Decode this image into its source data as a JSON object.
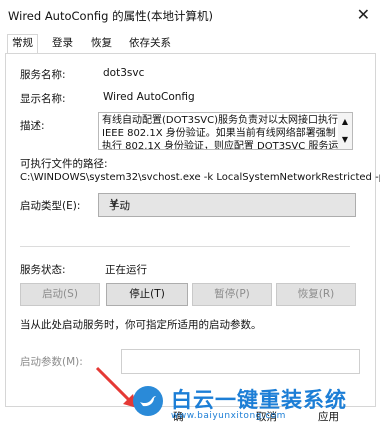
{
  "window": {
    "title": "Wired AutoConfig 的属性(本地计算机)"
  },
  "tabs": [
    {
      "label": "常规"
    },
    {
      "label": "登录"
    },
    {
      "label": "恢复"
    },
    {
      "label": "依存关系"
    }
  ],
  "general": {
    "service_name_label": "服务名称:",
    "service_name": "dot3svc",
    "display_name_label": "显示名称:",
    "display_name": "Wired AutoConfig",
    "description_label": "描述:",
    "description": "有线自动配置(DOT3SVC)服务负责对以太网接口执行 IEEE 802.1X 身份验证。如果当前有线网络部署强制执行 802.1X 身份验证，则应配置 DOT3SVC 服务运行以",
    "exec_path_label": "可执行文件的路径:",
    "exec_path": "C:\\WINDOWS\\system32\\svchost.exe -k LocalSystemNetworkRestricted -p",
    "startup_type_label": "启动类型(E):",
    "startup_type": "手动",
    "status_label": "服务状态:",
    "status": "正在运行",
    "buttons": {
      "start": "启动(S)",
      "stop": "停止(T)",
      "pause": "暂停(P)",
      "resume": "恢复(R)"
    },
    "hint": "当从此处启动服务时，你可指定所适用的启动参数。",
    "start_params_label": "启动参数(M):",
    "start_params_value": ""
  },
  "footer": {
    "ok": "确",
    "cancel": "取消",
    "apply": "应用"
  },
  "watermark": {
    "brand": "白云一键重装系统",
    "url": "www.baiyunxitong.com"
  },
  "colors": {
    "accent": "#1c7ed6"
  }
}
